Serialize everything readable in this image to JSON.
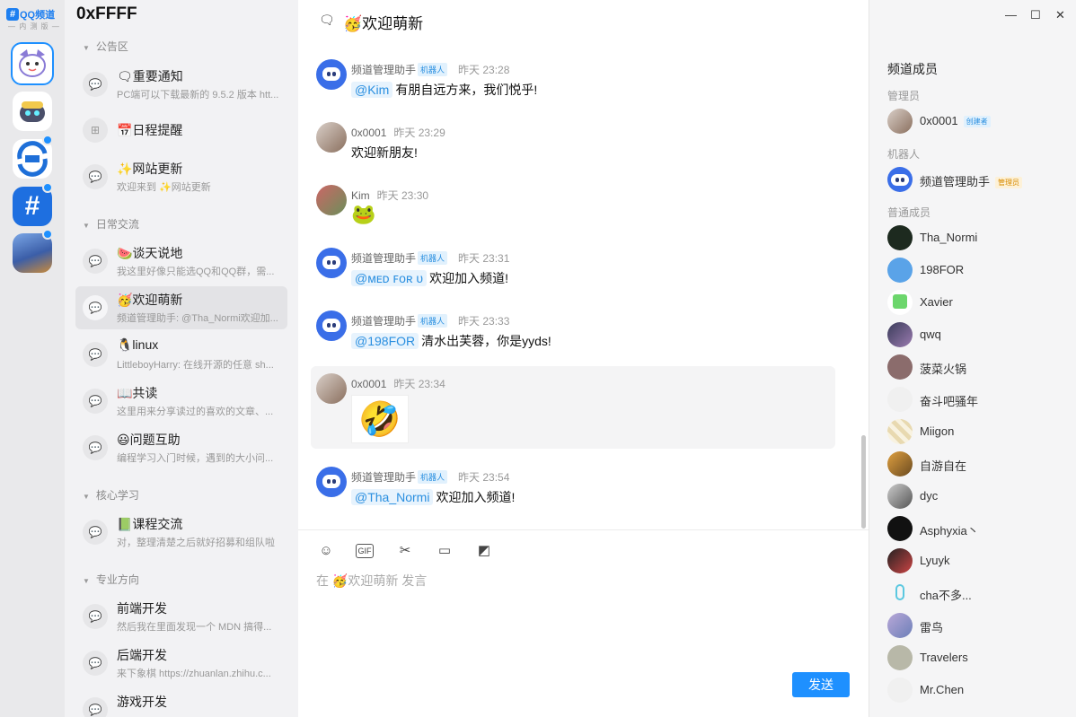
{
  "app": {
    "brand": "QQ频道",
    "brand_sub": "— 内 测 版 —"
  },
  "window_controls": {
    "minimize": "—",
    "maximize": "☐",
    "close": "✕"
  },
  "guild": {
    "name": "0xFFFF"
  },
  "colors": {
    "accent": "#1e90ff",
    "mention": "#2a8fe0",
    "admin_tag": "#eaa520"
  },
  "categories": [
    {
      "label": "公告区"
    },
    {
      "label": "日常交流"
    },
    {
      "label": "核心学习"
    },
    {
      "label": "专业方向"
    }
  ],
  "channels": [
    {
      "icon": "💬",
      "title": "🗨重要通知",
      "preview": "PC端可以下载最新的 9.5.2 版本 htt..."
    },
    {
      "icon": "⊞",
      "title": "📅日程提醒",
      "preview": ""
    },
    {
      "icon": "💬",
      "title": "✨网站更新",
      "preview": "欢迎来到 ✨网站更新"
    },
    {
      "icon": "💬",
      "title": "🍉谈天说地",
      "preview": "我这里好像只能选QQ和QQ群，需..."
    },
    {
      "icon": "💬",
      "title": "🥳欢迎萌新",
      "preview": "频道管理助手: @Tha_Normi欢迎加..."
    },
    {
      "icon": "💬",
      "title": "🐧linux",
      "preview": "LittleboyHarry: 在线开源的任意 sh..."
    },
    {
      "icon": "💬",
      "title": "📖共读",
      "preview": "这里用来分享读过的喜欢的文章、..."
    },
    {
      "icon": "💬",
      "title": "😃问题互助",
      "preview": "编程学习入门时候，遇到的大小问..."
    },
    {
      "icon": "💬",
      "title": "📗课程交流",
      "preview": "对，整理清楚之后就好招募和组队啦"
    },
    {
      "icon": "💬",
      "title": "前端开发",
      "preview": "然后我在里面发现一个 MDN 搞得..."
    },
    {
      "icon": "💬",
      "title": "后端开发",
      "preview": "来下象棋 https://zhuanlan.zhihu.c..."
    },
    {
      "icon": "💬",
      "title": "游戏开发",
      "preview": ""
    }
  ],
  "chat": {
    "channel_title": "🥳欢迎萌新",
    "placeholder": "在 🥳欢迎萌新 发言",
    "send_label": "发送",
    "tools": [
      "emoji-icon",
      "gif-icon",
      "scissors-icon",
      "folder-icon",
      "screen-icon"
    ],
    "tool_glyphs": [
      "☺",
      "GIF",
      "✂",
      "▭",
      "◩"
    ],
    "bot_tag": "机器人",
    "messages": [
      {
        "author": "频道管理助手",
        "bot": true,
        "time": "昨天 23:28",
        "mention": "@Kim",
        "text": "有朋自远方来，我们悦乎!"
      },
      {
        "author": "0x0001",
        "bot": false,
        "time": "昨天 23:29",
        "mention": "",
        "text": "欢迎新朋友!"
      },
      {
        "author": "Kim",
        "bot": false,
        "time": "昨天 23:30",
        "mention": "",
        "text": "",
        "sticker": "🐸"
      },
      {
        "author": "频道管理助手",
        "bot": true,
        "time": "昨天 23:31",
        "mention": "@ᴍᴇᴅ ꜰᴏʀ ᴜ",
        "text": "欢迎加入频道!"
      },
      {
        "author": "频道管理助手",
        "bot": true,
        "time": "昨天 23:33",
        "mention": "@198FOR",
        "text": "清水出芙蓉，你是yyds!"
      },
      {
        "author": "0x0001",
        "bot": false,
        "time": "昨天 23:34",
        "mention": "",
        "text": "",
        "sticker": "🤣"
      },
      {
        "author": "频道管理助手",
        "bot": true,
        "time": "昨天 23:54",
        "mention": "@Tha_Normi",
        "text": "欢迎加入频道!"
      }
    ]
  },
  "members": {
    "title": "频道成员",
    "groups": {
      "admin": "管理员",
      "bots": "机器人",
      "normal": "普通成员"
    },
    "admin": {
      "name": "0x0001",
      "tag": "创建者"
    },
    "bot": {
      "name": "频道管理助手",
      "tag": "管理员"
    },
    "normal": [
      "Tha_Normi",
      "198FOR",
      "Xavier",
      "qwq",
      "菠菜火锅",
      "奋斗吧骚年",
      "Miigon",
      "自游自在",
      "dyc",
      "Asphyxia丶",
      "Lyuyk",
      "cha不多...",
      "雷鸟",
      "Travelers",
      "Mr.Chen"
    ]
  }
}
